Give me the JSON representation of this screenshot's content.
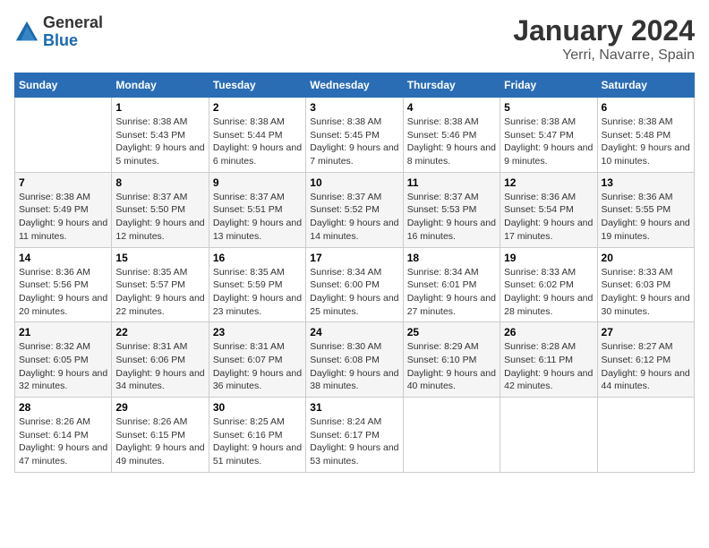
{
  "header": {
    "logo_general": "General",
    "logo_blue": "Blue",
    "title": "January 2024",
    "subtitle": "Yerri, Navarre, Spain"
  },
  "days_of_week": [
    "Sunday",
    "Monday",
    "Tuesday",
    "Wednesday",
    "Thursday",
    "Friday",
    "Saturday"
  ],
  "weeks": [
    [
      {
        "day": "",
        "sunrise": "",
        "sunset": "",
        "daylight": ""
      },
      {
        "day": "1",
        "sunrise": "Sunrise: 8:38 AM",
        "sunset": "Sunset: 5:43 PM",
        "daylight": "Daylight: 9 hours and 5 minutes."
      },
      {
        "day": "2",
        "sunrise": "Sunrise: 8:38 AM",
        "sunset": "Sunset: 5:44 PM",
        "daylight": "Daylight: 9 hours and 6 minutes."
      },
      {
        "day": "3",
        "sunrise": "Sunrise: 8:38 AM",
        "sunset": "Sunset: 5:45 PM",
        "daylight": "Daylight: 9 hours and 7 minutes."
      },
      {
        "day": "4",
        "sunrise": "Sunrise: 8:38 AM",
        "sunset": "Sunset: 5:46 PM",
        "daylight": "Daylight: 9 hours and 8 minutes."
      },
      {
        "day": "5",
        "sunrise": "Sunrise: 8:38 AM",
        "sunset": "Sunset: 5:47 PM",
        "daylight": "Daylight: 9 hours and 9 minutes."
      },
      {
        "day": "6",
        "sunrise": "Sunrise: 8:38 AM",
        "sunset": "Sunset: 5:48 PM",
        "daylight": "Daylight: 9 hours and 10 minutes."
      }
    ],
    [
      {
        "day": "7",
        "sunrise": "Sunrise: 8:38 AM",
        "sunset": "Sunset: 5:49 PM",
        "daylight": "Daylight: 9 hours and 11 minutes."
      },
      {
        "day": "8",
        "sunrise": "Sunrise: 8:37 AM",
        "sunset": "Sunset: 5:50 PM",
        "daylight": "Daylight: 9 hours and 12 minutes."
      },
      {
        "day": "9",
        "sunrise": "Sunrise: 8:37 AM",
        "sunset": "Sunset: 5:51 PM",
        "daylight": "Daylight: 9 hours and 13 minutes."
      },
      {
        "day": "10",
        "sunrise": "Sunrise: 8:37 AM",
        "sunset": "Sunset: 5:52 PM",
        "daylight": "Daylight: 9 hours and 14 minutes."
      },
      {
        "day": "11",
        "sunrise": "Sunrise: 8:37 AM",
        "sunset": "Sunset: 5:53 PM",
        "daylight": "Daylight: 9 hours and 16 minutes."
      },
      {
        "day": "12",
        "sunrise": "Sunrise: 8:36 AM",
        "sunset": "Sunset: 5:54 PM",
        "daylight": "Daylight: 9 hours and 17 minutes."
      },
      {
        "day": "13",
        "sunrise": "Sunrise: 8:36 AM",
        "sunset": "Sunset: 5:55 PM",
        "daylight": "Daylight: 9 hours and 19 minutes."
      }
    ],
    [
      {
        "day": "14",
        "sunrise": "Sunrise: 8:36 AM",
        "sunset": "Sunset: 5:56 PM",
        "daylight": "Daylight: 9 hours and 20 minutes."
      },
      {
        "day": "15",
        "sunrise": "Sunrise: 8:35 AM",
        "sunset": "Sunset: 5:57 PM",
        "daylight": "Daylight: 9 hours and 22 minutes."
      },
      {
        "day": "16",
        "sunrise": "Sunrise: 8:35 AM",
        "sunset": "Sunset: 5:59 PM",
        "daylight": "Daylight: 9 hours and 23 minutes."
      },
      {
        "day": "17",
        "sunrise": "Sunrise: 8:34 AM",
        "sunset": "Sunset: 6:00 PM",
        "daylight": "Daylight: 9 hours and 25 minutes."
      },
      {
        "day": "18",
        "sunrise": "Sunrise: 8:34 AM",
        "sunset": "Sunset: 6:01 PM",
        "daylight": "Daylight: 9 hours and 27 minutes."
      },
      {
        "day": "19",
        "sunrise": "Sunrise: 8:33 AM",
        "sunset": "Sunset: 6:02 PM",
        "daylight": "Daylight: 9 hours and 28 minutes."
      },
      {
        "day": "20",
        "sunrise": "Sunrise: 8:33 AM",
        "sunset": "Sunset: 6:03 PM",
        "daylight": "Daylight: 9 hours and 30 minutes."
      }
    ],
    [
      {
        "day": "21",
        "sunrise": "Sunrise: 8:32 AM",
        "sunset": "Sunset: 6:05 PM",
        "daylight": "Daylight: 9 hours and 32 minutes."
      },
      {
        "day": "22",
        "sunrise": "Sunrise: 8:31 AM",
        "sunset": "Sunset: 6:06 PM",
        "daylight": "Daylight: 9 hours and 34 minutes."
      },
      {
        "day": "23",
        "sunrise": "Sunrise: 8:31 AM",
        "sunset": "Sunset: 6:07 PM",
        "daylight": "Daylight: 9 hours and 36 minutes."
      },
      {
        "day": "24",
        "sunrise": "Sunrise: 8:30 AM",
        "sunset": "Sunset: 6:08 PM",
        "daylight": "Daylight: 9 hours and 38 minutes."
      },
      {
        "day": "25",
        "sunrise": "Sunrise: 8:29 AM",
        "sunset": "Sunset: 6:10 PM",
        "daylight": "Daylight: 9 hours and 40 minutes."
      },
      {
        "day": "26",
        "sunrise": "Sunrise: 8:28 AM",
        "sunset": "Sunset: 6:11 PM",
        "daylight": "Daylight: 9 hours and 42 minutes."
      },
      {
        "day": "27",
        "sunrise": "Sunrise: 8:27 AM",
        "sunset": "Sunset: 6:12 PM",
        "daylight": "Daylight: 9 hours and 44 minutes."
      }
    ],
    [
      {
        "day": "28",
        "sunrise": "Sunrise: 8:26 AM",
        "sunset": "Sunset: 6:14 PM",
        "daylight": "Daylight: 9 hours and 47 minutes."
      },
      {
        "day": "29",
        "sunrise": "Sunrise: 8:26 AM",
        "sunset": "Sunset: 6:15 PM",
        "daylight": "Daylight: 9 hours and 49 minutes."
      },
      {
        "day": "30",
        "sunrise": "Sunrise: 8:25 AM",
        "sunset": "Sunset: 6:16 PM",
        "daylight": "Daylight: 9 hours and 51 minutes."
      },
      {
        "day": "31",
        "sunrise": "Sunrise: 8:24 AM",
        "sunset": "Sunset: 6:17 PM",
        "daylight": "Daylight: 9 hours and 53 minutes."
      },
      {
        "day": "",
        "sunrise": "",
        "sunset": "",
        "daylight": ""
      },
      {
        "day": "",
        "sunrise": "",
        "sunset": "",
        "daylight": ""
      },
      {
        "day": "",
        "sunrise": "",
        "sunset": "",
        "daylight": ""
      }
    ]
  ]
}
